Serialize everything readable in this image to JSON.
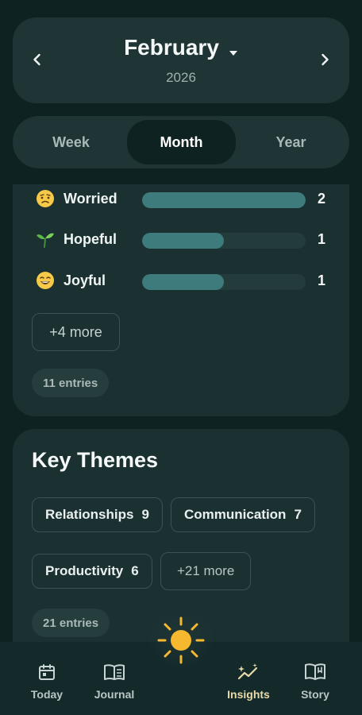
{
  "header": {
    "month": "February",
    "year": "2026",
    "prev_icon": "chevron-left-icon",
    "next_icon": "chevron-right-icon",
    "dropdown_icon": "caret-down-icon"
  },
  "period_tabs": [
    {
      "label": "Week",
      "active": false
    },
    {
      "label": "Month",
      "active": true
    },
    {
      "label": "Year",
      "active": false
    }
  ],
  "emotions": {
    "items": [
      {
        "icon": "worried-face-icon",
        "label": "Worried",
        "count": "2",
        "fill": 1.0
      },
      {
        "icon": "seedling-icon",
        "label": "Hopeful",
        "count": "1",
        "fill": 0.5
      },
      {
        "icon": "grinning-face-icon",
        "label": "Joyful",
        "count": "1",
        "fill": 0.5
      }
    ],
    "more_label": "+4 more",
    "entries_label": "11 entries"
  },
  "themes": {
    "title": "Key Themes",
    "chips": [
      {
        "label": "Relationships",
        "count": "9"
      },
      {
        "label": "Communication",
        "count": "7"
      },
      {
        "label": "Productivity",
        "count": "6"
      }
    ],
    "more_label": "+21 more",
    "entries_label": "21 entries"
  },
  "bottom_nav": [
    {
      "label": "Today",
      "icon": "calendar-icon",
      "active": false
    },
    {
      "label": "Journal",
      "icon": "book-icon",
      "active": false
    },
    {
      "label": "Insights",
      "icon": "sparkle-chart-icon",
      "active": true
    },
    {
      "label": "Story",
      "icon": "open-book-icon",
      "active": false
    }
  ],
  "fab": {
    "icon": "sun-icon"
  },
  "colors": {
    "background": "#0f2222",
    "card": "#1b3131",
    "bar_fill": "#3e7b7c",
    "accent_sun": "#f5b82e",
    "active_nav": "#e8dba8"
  }
}
